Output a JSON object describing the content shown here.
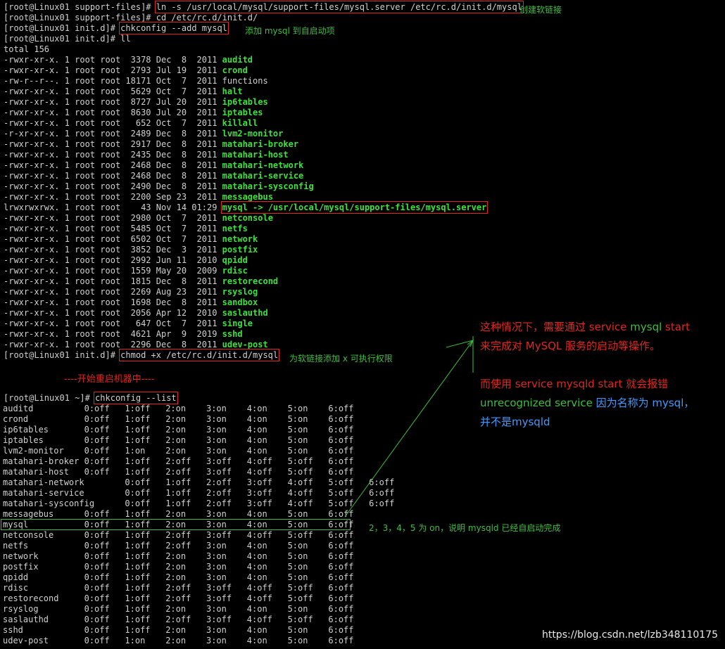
{
  "session1": {
    "line1_prompt": "[root@Linux01 support-files]# ",
    "line1_cmd": "ln -s /usr/local/mysql/support-files/mysql.server /etc/rc.d/init.d/mysql",
    "line2": "[root@Linux01 support-files]# cd /etc/rc.d/init.d/",
    "line3_prompt": "[root@Linux01 init.d]# ",
    "line3_cmd": "chkconfig --add mysql",
    "line4": "[root@Linux01 init.d]# ll",
    "total": "total 156",
    "files": [
      {
        "meta": "-rwxr-xr-x. 1 root root  3378 Dec  8  2011 ",
        "name": "auditd",
        "exec": true
      },
      {
        "meta": "-rwxr-xr-x. 1 root root  2793 Jul 19  2011 ",
        "name": "crond",
        "exec": true
      },
      {
        "meta": "-rw-r--r--. 1 root root 18171 Oct  7  2011 ",
        "name": "functions",
        "exec": false
      },
      {
        "meta": "-rwxr-xr-x. 1 root root  5629 Oct  7  2011 ",
        "name": "halt",
        "exec": true
      },
      {
        "meta": "-rwxr-xr-x. 1 root root  8727 Jul 20  2011 ",
        "name": "ip6tables",
        "exec": true
      },
      {
        "meta": "-rwxr-xr-x. 1 root root  8630 Jul 20  2011 ",
        "name": "iptables",
        "exec": true
      },
      {
        "meta": "-rwxr-xr-x. 1 root root   652 Oct  7  2011 ",
        "name": "killall",
        "exec": true
      },
      {
        "meta": "-r-xr-xr-x. 1 root root  2489 Dec  8  2011 ",
        "name": "lvm2-monitor",
        "exec": true
      },
      {
        "meta": "-rwxr-xr-x. 1 root root  2917 Dec  8  2011 ",
        "name": "matahari-broker",
        "exec": true
      },
      {
        "meta": "-rwxr-xr-x. 1 root root  2435 Dec  8  2011 ",
        "name": "matahari-host",
        "exec": true
      },
      {
        "meta": "-rwxr-xr-x. 1 root root  2468 Dec  8  2011 ",
        "name": "matahari-network",
        "exec": true
      },
      {
        "meta": "-rwxr-xr-x. 1 root root  2468 Dec  8  2011 ",
        "name": "matahari-service",
        "exec": true
      },
      {
        "meta": "-rwxr-xr-x. 1 root root  2490 Dec  8  2011 ",
        "name": "matahari-sysconfig",
        "exec": true
      },
      {
        "meta": "-rwxr-xr-x. 1 root root  2200 Sep 23  2011 ",
        "name": "messagebus",
        "exec": true
      },
      {
        "meta": "lrwxrwxrwx. 1 root root    43 Nov 14 01:29 ",
        "name": "mysql -> /usr/local/mysql/support-files/mysql.server",
        "exec": true,
        "link": true
      },
      {
        "meta": "-rwxr-xr-x. 1 root root  2980 Oct  7  2011 ",
        "name": "netconsole",
        "exec": true
      },
      {
        "meta": "-rwxr-xr-x. 1 root root  5485 Oct  7  2011 ",
        "name": "netfs",
        "exec": true
      },
      {
        "meta": "-rwxr-xr-x. 1 root root  6502 Oct  7  2011 ",
        "name": "network",
        "exec": true
      },
      {
        "meta": "-rwxr-xr-x. 1 root root  3852 Dec  3  2011 ",
        "name": "postfix",
        "exec": true
      },
      {
        "meta": "-rwxr-xr-x. 1 root root  2992 Jun 11  2010 ",
        "name": "qpidd",
        "exec": true
      },
      {
        "meta": "-rwxr-xr-x. 1 root root  1559 May 20  2009 ",
        "name": "rdisc",
        "exec": true
      },
      {
        "meta": "-rwxr-xr-x. 1 root root  1815 Dec  8  2011 ",
        "name": "restorecond",
        "exec": true
      },
      {
        "meta": "-rwxr-xr-x. 1 root root  2269 Aug 23  2011 ",
        "name": "rsyslog",
        "exec": true
      },
      {
        "meta": "-rwxr-xr-x. 1 root root  1698 Dec  8  2011 ",
        "name": "sandbox",
        "exec": true
      },
      {
        "meta": "-rwxr-xr-x. 1 root root  2056 Apr 12  2010 ",
        "name": "saslauthd",
        "exec": true
      },
      {
        "meta": "-rwxr-xr-x. 1 root root   647 Oct  7  2011 ",
        "name": "single",
        "exec": true
      },
      {
        "meta": "-rwxr-xr-x. 1 root root  4621 Apr  9  2019 ",
        "name": "sshd",
        "exec": true
      },
      {
        "meta": "-rwxr-xr-x. 1 root root  2296 Dec  8  2011 ",
        "name": "udev-post",
        "exec": true
      }
    ],
    "chmod_prompt": "[root@Linux01 init.d]# ",
    "chmod_cmd": "chmod +x /etc/rc.d/init.d/mysql"
  },
  "reboot_text": "----开始重启机器中----",
  "session2": {
    "prompt": "[root@Linux01 ~]# ",
    "cmd": "chkconfig --list",
    "services": [
      "auditd          0:off   1:off   2:on    3:on    4:on    5:on    6:off",
      "crond           0:off   1:off   2:on    3:on    4:on    5:on    6:off",
      "ip6tables       0:off   1:off   2:on    3:on    4:on    5:on    6:off",
      "iptables        0:off   1:off   2:on    3:on    4:on    5:on    6:off",
      "lvm2-monitor    0:off   1:on    2:on    3:on    4:on    5:on    6:off",
      "matahari-broker 0:off   1:off   2:off   3:off   4:off   5:off   6:off",
      "matahari-host   0:off   1:off   2:off   3:off   4:off   5:off   6:off",
      "matahari-network        0:off   1:off   2:off   3:off   4:off   5:off   6:off",
      "matahari-service        0:off   1:off   2:off   3:off   4:off   5:off   6:off",
      "matahari-sysconfig      0:off   1:off   2:off   3:off   4:off   5:off   6:off",
      "messagebus      0:off   1:off   2:on    3:on    4:on    5:on    6:off",
      "mysql           0:off   1:off   2:on    3:on    4:on    5:on    6:off",
      "netconsole      0:off   1:off   2:off   3:off   4:off   5:off   6:off",
      "netfs           0:off   1:off   2:off   3:on    4:on    5:on    6:off",
      "network         0:off   1:off   2:on    3:on    4:on    5:on    6:off",
      "postfix         0:off   1:off   2:on    3:on    4:on    5:on    6:off",
      "qpidd           0:off   1:off   2:on    3:on    4:on    5:on    6:off",
      "rdisc           0:off   1:off   2:off   3:off   4:off   5:off   6:off",
      "restorecond     0:off   1:off   2:off   3:off   4:off   5:off   6:off",
      "rsyslog         0:off   1:off   2:on    3:on    4:on    5:on    6:off",
      "saslauthd       0:off   1:off   2:off   3:off   4:off   5:off   6:off",
      "sshd            0:off   1:off   2:on    3:on    4:on    5:on    6:off",
      "udev-post       0:off   1:on    2:on    3:on    4:on    5:on    6:off"
    ]
  },
  "annotations": {
    "create_link": "创建软链接",
    "add_startup": "添加 mysql 到自启动项",
    "chmod_note": "为软链接添加 x 可执行权限",
    "mysql_row_note": "2，3，4，5 为 on，说明 mysqld 已经自启动完成",
    "note_line1_a": "这种情况下，需要通过 service ",
    "note_line1_b": "mysql",
    "note_line1_c": " start",
    "note_line2": "来完成对 MySQL 服务的启动等操作。",
    "note_line3": "而使用 service mysqld start 就会报错",
    "note_line4_a": "unrecognized service ",
    "note_line4_b": "因为名称为 mysql，",
    "note_line5": "并不是mysqld"
  },
  "watermark": "https://blog.csdn.net/lzb348110175",
  "colors": {
    "background": "#000000",
    "terminal_text": "#d0d0d0",
    "executable": "#3ce13c",
    "highlight_red": "#e0261f",
    "annotation_green": "#3cbf3c",
    "annotation_blue": "#3d9bff"
  }
}
